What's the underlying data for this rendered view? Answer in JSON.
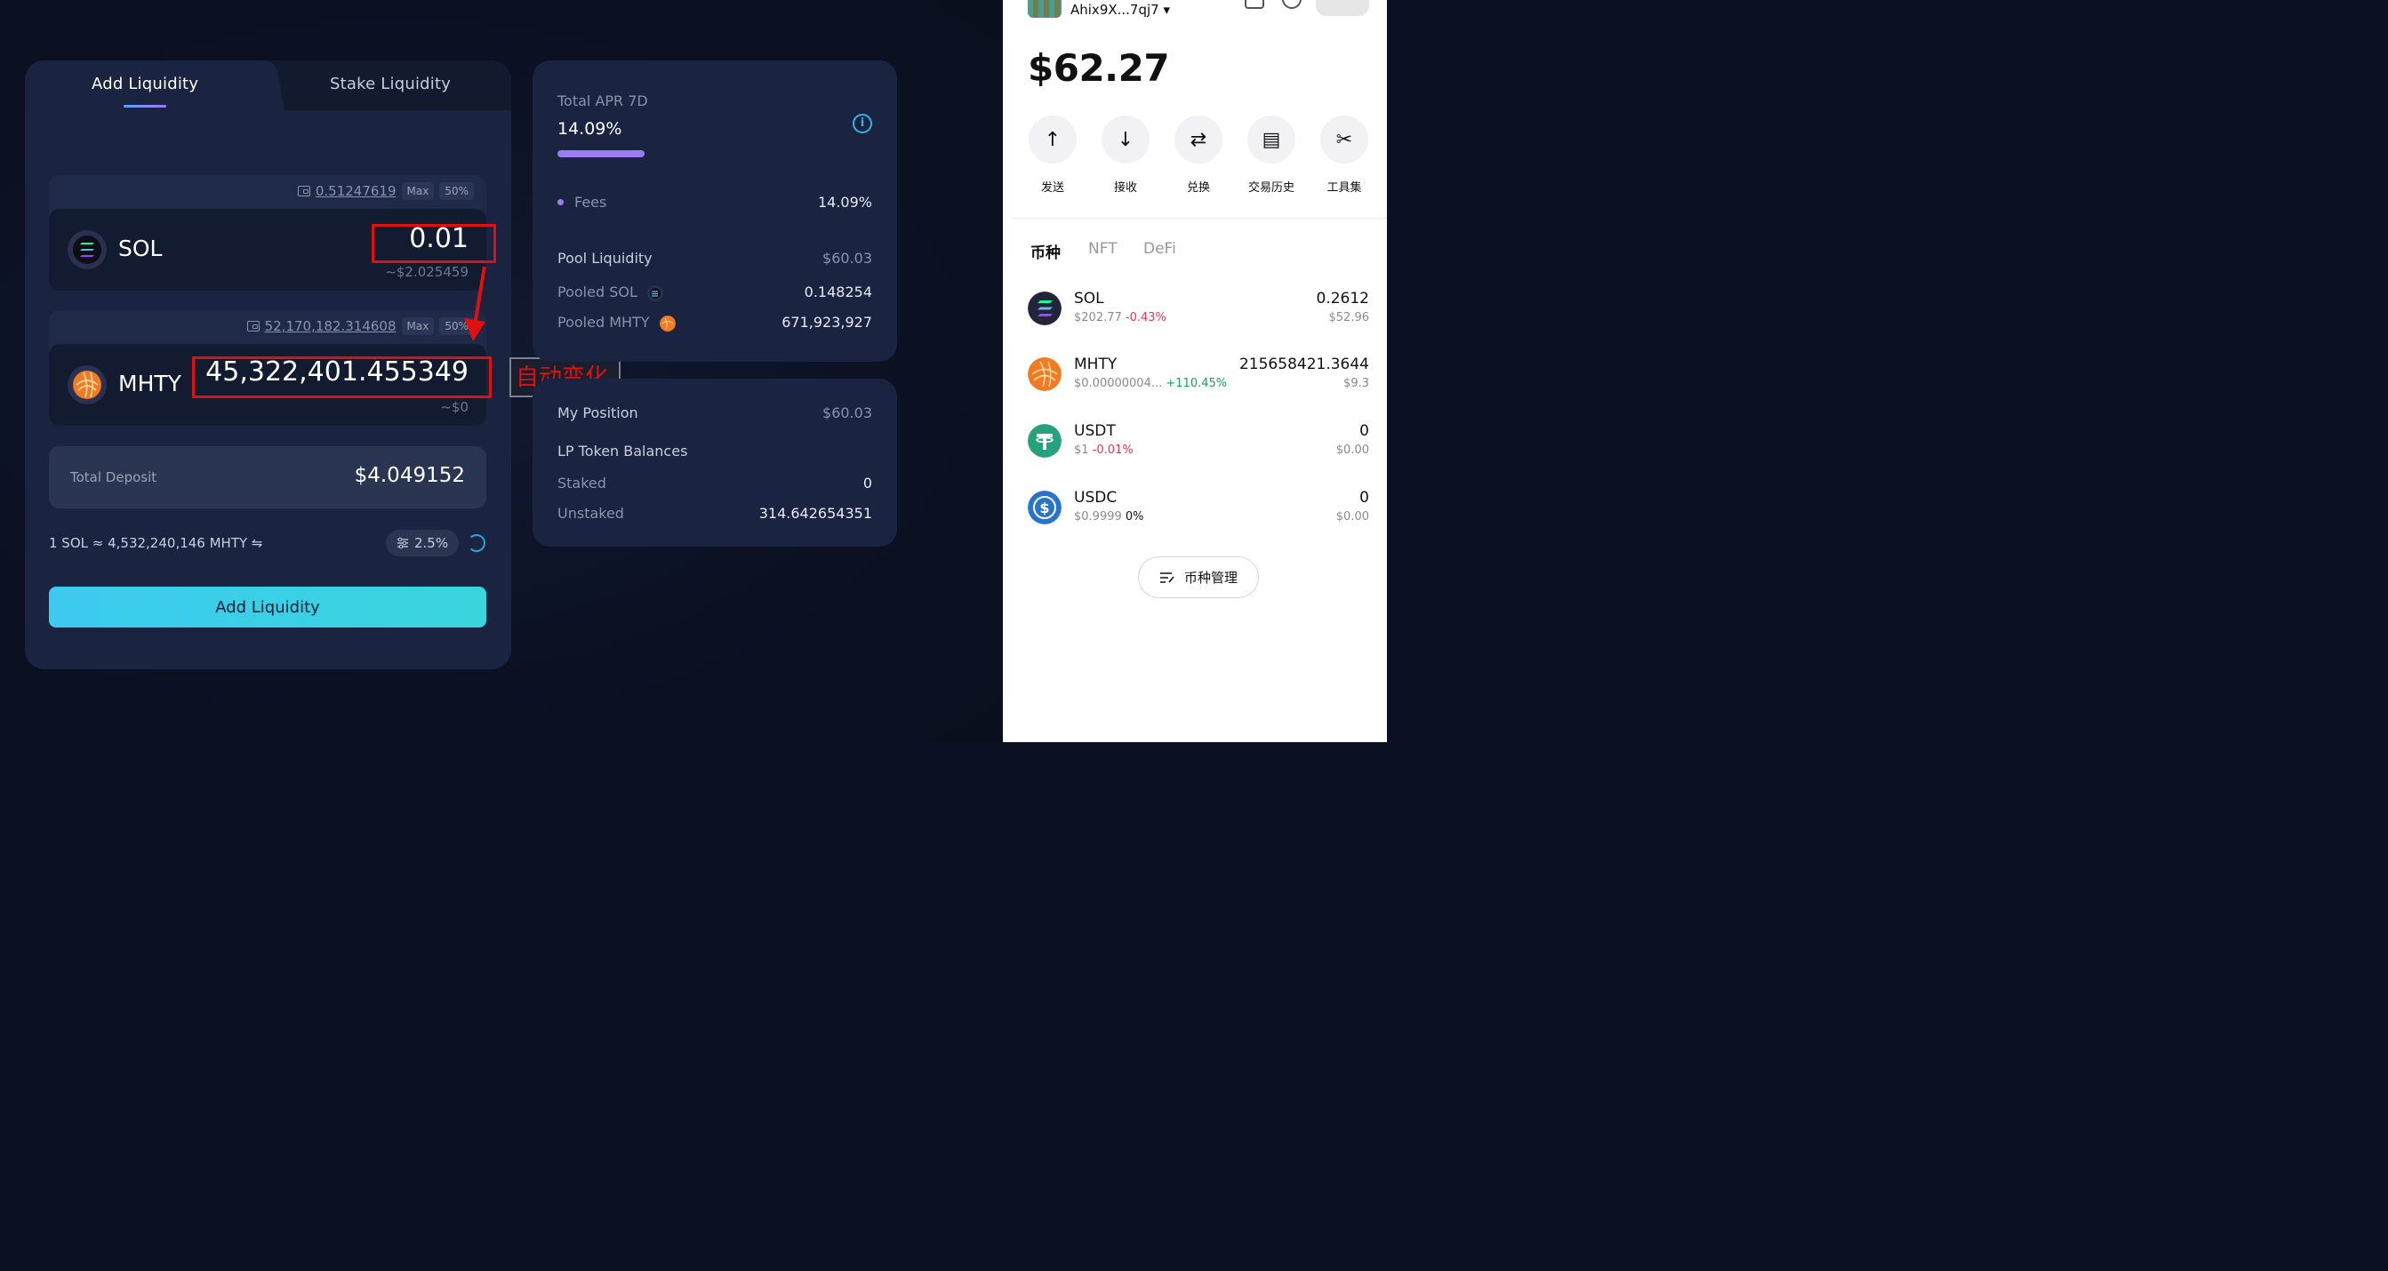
{
  "liquidity": {
    "tabs": {
      "add": "Add Liquidity",
      "stake": "Stake Liquidity"
    },
    "sol": {
      "balance": "0.51247619",
      "max": "Max",
      "half": "50%",
      "name": "SOL",
      "amount": "0.01",
      "usd": "~$2.025459"
    },
    "mhty": {
      "balance": "52,170,182.314608",
      "max": "Max",
      "half": "50%",
      "name": "MHTY",
      "amount": "45,322,401.455349",
      "usd": "~$0"
    },
    "total_deposit": {
      "label": "Total Deposit",
      "value": "$4.049152"
    },
    "rate": "1 SOL ≈ 4,532,240,146 MHTY ⇋",
    "slippage": "2.5%",
    "add_button": "Add Liquidity"
  },
  "annotation": {
    "text": "自动变化"
  },
  "pool": {
    "apr_label": "Total APR 7D",
    "apr_value": "14.09%",
    "info_glyph": "i",
    "fees_label": "Fees",
    "fees_value": "14.09%",
    "pool_liquidity_label": "Pool Liquidity",
    "pool_liquidity_value": "$60.03",
    "pooled_sol_label": "Pooled SOL",
    "pooled_sol_value": "0.148254",
    "pooled_mhty_label": "Pooled MHTY",
    "pooled_mhty_value": "671,923,927"
  },
  "position": {
    "label": "My Position",
    "value": "$60.03",
    "lp_label": "LP Token Balances",
    "staked_label": "Staked",
    "staked_value": "0",
    "unstaked_label": "Unstaked",
    "unstaked_value": "314.642654351"
  },
  "wallet": {
    "address": "Ahix9X...7qj7 ▾",
    "balance": "$62.27",
    "actions": [
      {
        "label": "发送",
        "glyph": "↑"
      },
      {
        "label": "接收",
        "glyph": "↓"
      },
      {
        "label": "兑换",
        "glyph": "⇄"
      },
      {
        "label": "交易历史",
        "glyph": "▤"
      },
      {
        "label": "工具集",
        "glyph": "✂"
      }
    ],
    "tabs": [
      "币种",
      "NFT",
      "DeFi"
    ],
    "assets": [
      {
        "name": "SOL",
        "price": "$202.77",
        "change": "-0.43%",
        "amount": "0.2612",
        "value": "$52.96"
      },
      {
        "name": "MHTY",
        "price": "$0.00000004...",
        "change": "+110.45%",
        "amount": "215658421.3644",
        "value": "$9.3"
      },
      {
        "name": "USDT",
        "price": "$1",
        "change": "-0.01%",
        "amount": "0",
        "value": "$0.00"
      },
      {
        "name": "USDC",
        "price": "$0.9999",
        "change": "0%",
        "amount": "0",
        "value": "$0.00"
      }
    ],
    "manage_button": "币种管理"
  },
  "colors": {
    "accent_cyan": "#3ccaf0",
    "accent_purple": "#9a7cf0",
    "annotation_red": "#e01010",
    "negative": "#e8344e",
    "positive": "#18a058"
  }
}
